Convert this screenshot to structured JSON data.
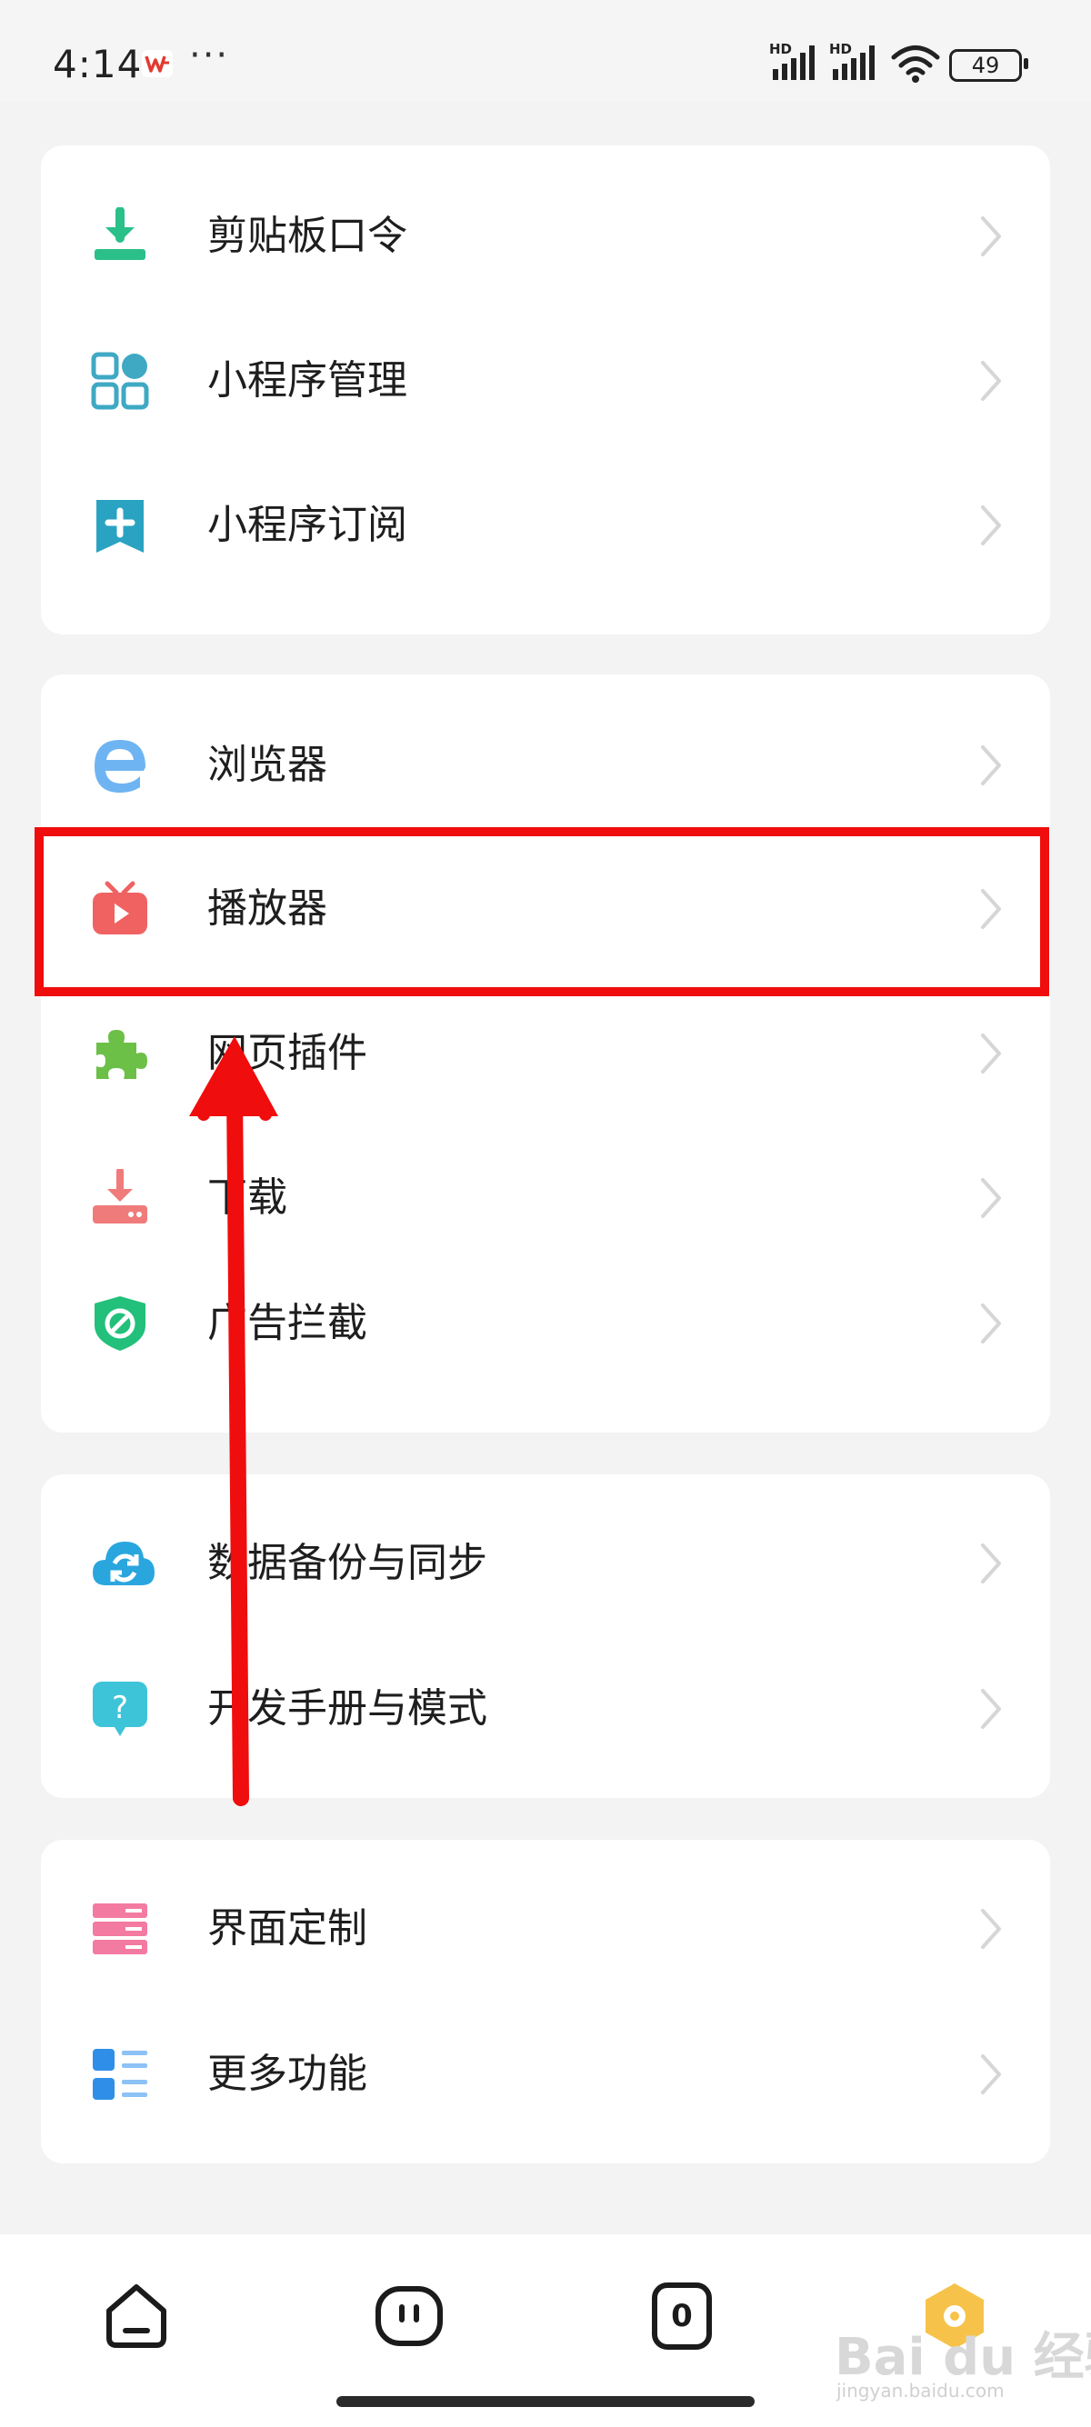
{
  "status_bar": {
    "time": "4:14",
    "more": "···",
    "signal_1_label": "HD",
    "signal_2_label": "HD",
    "battery": "49"
  },
  "groups": [
    {
      "items": [
        {
          "label": "剪贴板口令",
          "icon": "clipboard-download-icon"
        },
        {
          "label": "小程序管理",
          "icon": "apps-grid-icon"
        },
        {
          "label": "小程序订阅",
          "icon": "bookmark-add-icon"
        }
      ]
    },
    {
      "items": [
        {
          "label": "浏览器",
          "icon": "browser-e-icon"
        },
        {
          "label": "播放器",
          "icon": "tv-play-icon"
        },
        {
          "label": "网页插件",
          "icon": "puzzle-icon"
        },
        {
          "label": "下载",
          "icon": "download-tray-icon"
        },
        {
          "label": "广告拦截",
          "icon": "shield-block-icon"
        }
      ]
    },
    {
      "items": [
        {
          "label": "数据备份与同步",
          "icon": "cloud-sync-icon"
        },
        {
          "label": "开发手册与模式",
          "icon": "help-bubble-icon"
        }
      ]
    },
    {
      "items": [
        {
          "label": "界面定制",
          "icon": "layout-custom-icon"
        },
        {
          "label": "更多功能",
          "icon": "more-list-icon"
        }
      ]
    }
  ],
  "bottom_nav": {
    "tab_count": "0"
  },
  "watermark": {
    "brand": "Bai du 经验",
    "url": "jingyan.baidu.com"
  },
  "colors": {
    "highlight": "#f00d0d",
    "green": "#2bbf8a",
    "teal": "#3fa9c4",
    "red_play": "#f06262"
  }
}
